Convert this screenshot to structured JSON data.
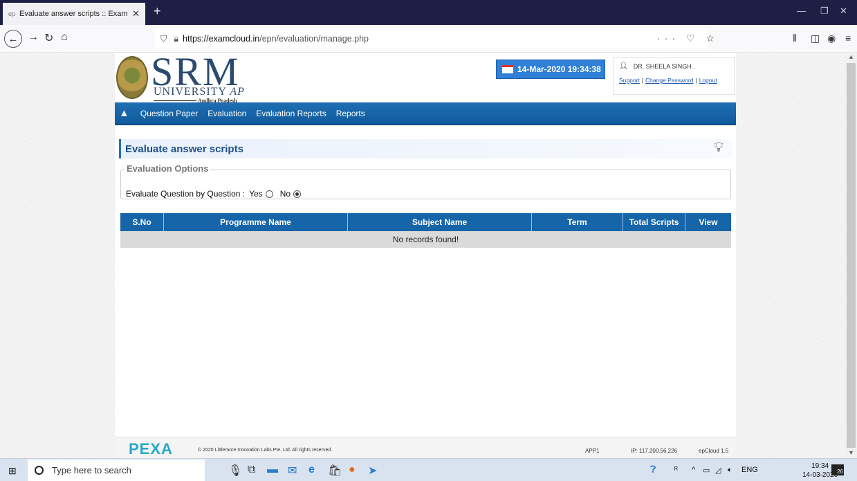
{
  "browser": {
    "tab_title": "Evaluate answer scripts :: Exam",
    "tab_favicon": "ep",
    "url_domain": "https://examcloud.in",
    "url_path": "/epn/evaluation/manage.php"
  },
  "header": {
    "logo_main": "SRM",
    "logo_university": "UNIVERSITY",
    "logo_ap": "AP",
    "logo_sub": "Andhra Pradesh",
    "datetime": "14-Mar-2020 19:34:38",
    "user_name": "DR. SHEELA SINGH .",
    "link_support": "Support",
    "link_change_password": "Change Password",
    "link_logout": "Logout"
  },
  "menu": {
    "items": [
      "Question Paper",
      "Evaluation",
      "Evaluation Reports",
      "Reports"
    ]
  },
  "main": {
    "title": "Evaluate answer scripts",
    "options_legend": "Evaluation Options",
    "question_label": "Evaluate Question by Question :",
    "yes_label": "Yes",
    "no_label": "No",
    "selected_option": "No"
  },
  "table": {
    "columns": [
      "S.No",
      "Programme Name",
      "Subject Name",
      "Term",
      "Total Scripts",
      "View"
    ],
    "empty_message": "No records found!"
  },
  "footer": {
    "brand": "PEXA",
    "copyright": "© 2020 Littlemore Innovation Labs Pte. Ltd. All rights reserved.",
    "server": "APP1",
    "ip": "IP: 117.200.56.226",
    "version": "epCloud 1.5"
  },
  "taskbar": {
    "search_placeholder": "Type here to search",
    "language": "ENG",
    "time": "19:34",
    "date": "14-03-2020",
    "notifications": "26"
  },
  "colors": {
    "menu_blue": "#1565a8",
    "date_blue": "#2f80d6",
    "title_blue": "#1f4f8a",
    "pexa_teal": "#27a8c8"
  }
}
